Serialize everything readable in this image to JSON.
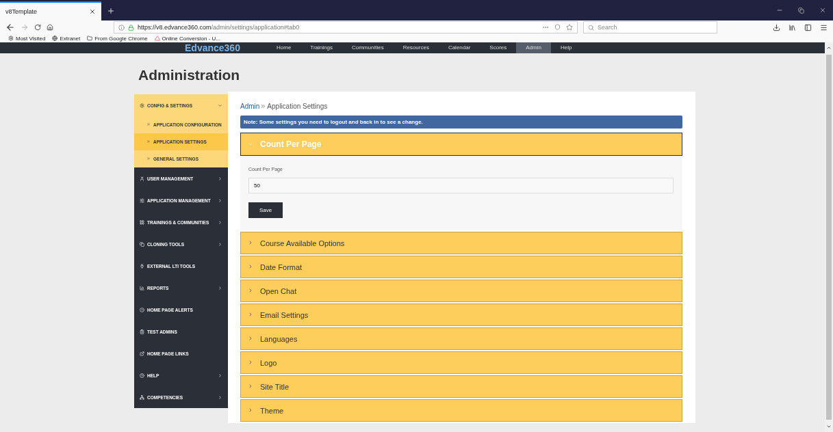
{
  "browser": {
    "tab": {
      "title": "v8Template",
      "selected": true
    },
    "url": {
      "host": "https://v8.edvance360.com",
      "path": "/admin/settings/application#tab0"
    },
    "search": {
      "placeholder": "Search"
    },
    "bookmarks": [
      "Most Visited",
      "Extranet",
      "From Google Chrome",
      "Online Conversion - U..."
    ]
  },
  "site_nav": {
    "logo": "Edvance360",
    "items": [
      {
        "label": "Home",
        "selected": false
      },
      {
        "label": "Trainings",
        "selected": false
      },
      {
        "label": "Communities",
        "selected": false
      },
      {
        "label": "Resources",
        "selected": false
      },
      {
        "label": "Calendar",
        "selected": false
      },
      {
        "label": "Scores",
        "selected": false
      },
      {
        "label": "Admin",
        "selected": true
      },
      {
        "label": "Help",
        "selected": false
      }
    ]
  },
  "page_title": "Administration",
  "sidebar": {
    "items": [
      {
        "label": "CONFIG & SETTINGS",
        "expandable": true,
        "expanded": true,
        "children": [
          {
            "label": "APPLICATION CONFIGURATION",
            "selected": false
          },
          {
            "label": "APPLICATION SETTINGS",
            "selected": true
          },
          {
            "label": "GENERAL SETTINGS",
            "selected": false
          }
        ]
      },
      {
        "label": "USER MANAGEMENT",
        "expandable": true,
        "expanded": false
      },
      {
        "label": "APPLICATION MANAGEMENT",
        "expandable": true,
        "expanded": false
      },
      {
        "label": "TRAININGS & COMMUNITIES",
        "expandable": true,
        "expanded": false
      },
      {
        "label": "CLONING TOOLS",
        "expandable": true,
        "expanded": false
      },
      {
        "label": "EXTERNAL LTI TOOLS",
        "expandable": false,
        "expanded": false
      },
      {
        "label": "REPORTS",
        "expandable": true,
        "expanded": false
      },
      {
        "label": "HOME PAGE ALERTS",
        "expandable": false,
        "expanded": false
      },
      {
        "label": "TEST ADMINS",
        "expandable": false,
        "expanded": false
      },
      {
        "label": "HOME PAGE LINKS",
        "expandable": false,
        "expanded": false
      },
      {
        "label": "HELP",
        "expandable": true,
        "expanded": false
      },
      {
        "label": "COMPETENCIES",
        "expandable": true,
        "expanded": false
      }
    ]
  },
  "breadcrumb": {
    "link": "Admin",
    "current": "Application Settings"
  },
  "note": "Note: Some settings you need to logout and back in to see a change.",
  "sections": [
    {
      "title": "Count Per Page",
      "expanded": true,
      "field": {
        "label": "Count Per Page",
        "value": "50"
      },
      "button": "Save"
    },
    {
      "title": "Course Available Options",
      "expanded": false
    },
    {
      "title": "Date Format",
      "expanded": false
    },
    {
      "title": "Open Chat",
      "expanded": false
    },
    {
      "title": "Email Settings",
      "expanded": false
    },
    {
      "title": "Languages",
      "expanded": false
    },
    {
      "title": "Logo",
      "expanded": false
    },
    {
      "title": "Site Title",
      "expanded": false
    },
    {
      "title": "Theme",
      "expanded": false
    }
  ]
}
